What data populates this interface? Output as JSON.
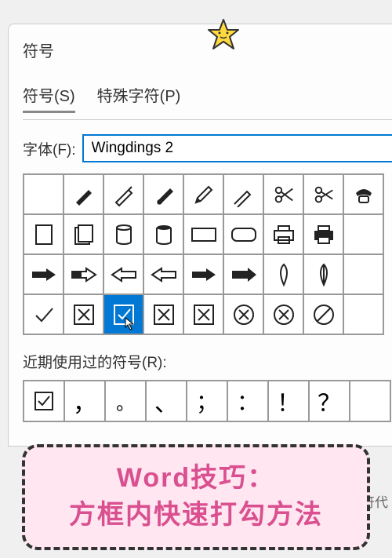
{
  "dialog": {
    "title": "符号",
    "tabs": [
      "符号(S)",
      "特殊字符(P)"
    ],
    "activeTab": 0,
    "fontLabel": "字体(F):",
    "fontValue": "Wingdings 2",
    "recentLabel": "近期使用过的符号(R):",
    "bgText": "符代"
  },
  "symbolGrid": {
    "rows": 4,
    "cols": 9,
    "cells": [
      {
        "glyph": "blank"
      },
      {
        "glyph": "pen1"
      },
      {
        "glyph": "pen2"
      },
      {
        "glyph": "brush"
      },
      {
        "glyph": "pencil"
      },
      {
        "glyph": "marker"
      },
      {
        "glyph": "scissors1"
      },
      {
        "glyph": "scissors2"
      },
      {
        "glyph": "phone"
      },
      {
        "glyph": "rect"
      },
      {
        "glyph": "docs"
      },
      {
        "glyph": "can1"
      },
      {
        "glyph": "can2"
      },
      {
        "glyph": "wide-rect"
      },
      {
        "glyph": "round-rect"
      },
      {
        "glyph": "printer1"
      },
      {
        "glyph": "printer2"
      },
      {
        "glyph": "partial1"
      },
      {
        "glyph": "hand-right1"
      },
      {
        "glyph": "hand-right2"
      },
      {
        "glyph": "hand-left1"
      },
      {
        "glyph": "hand-left2"
      },
      {
        "glyph": "hand-right3"
      },
      {
        "glyph": "hand-right4"
      },
      {
        "glyph": "leaf1"
      },
      {
        "glyph": "leaf2"
      },
      {
        "glyph": "partial2"
      },
      {
        "glyph": "check"
      },
      {
        "glyph": "xbox1"
      },
      {
        "glyph": "checkbox-sel",
        "selected": true
      },
      {
        "glyph": "xbox2"
      },
      {
        "glyph": "xbox3"
      },
      {
        "glyph": "xcircle1"
      },
      {
        "glyph": "xcircle2"
      },
      {
        "glyph": "prohibit"
      },
      {
        "glyph": "partial3"
      }
    ]
  },
  "recentGrid": {
    "cells": [
      {
        "glyph": "checkbox"
      },
      {
        "glyph": "comma"
      },
      {
        "glyph": "circle"
      },
      {
        "glyph": "backtick"
      },
      {
        "glyph": "semicolon"
      },
      {
        "glyph": "colon"
      },
      {
        "glyph": "exclaim"
      },
      {
        "glyph": "question"
      },
      {
        "glyph": "partial"
      }
    ]
  },
  "tip": {
    "line1": "Word技巧：",
    "line2": "方框内快速打勾方法"
  }
}
